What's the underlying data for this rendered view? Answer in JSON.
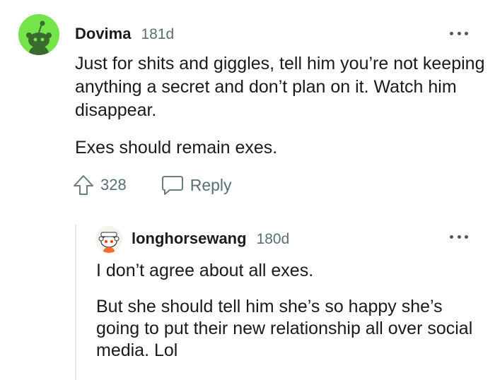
{
  "comment": {
    "author": "Dovima",
    "age": "181d",
    "paragraphs": [
      "Just for shits and giggles, tell him you’re not keeping anything a secret and don’t plan on it. Watch him disappear.",
      "Exes should remain exes."
    ],
    "vote_count": "328",
    "reply_label": "Reply",
    "avatar_color": "#75e34a"
  },
  "reply_comment": {
    "author": "longhorsewang",
    "age": "180d",
    "paragraphs": [
      "I don’t agree about all exes.",
      "But she should tell him she’s so happy she’s going to put their new relationship all over social media. Lol"
    ]
  },
  "icons": [
    "snoo-avatar-icon",
    "more-options-icon",
    "upvote-icon",
    "reply-bubble-icon"
  ]
}
